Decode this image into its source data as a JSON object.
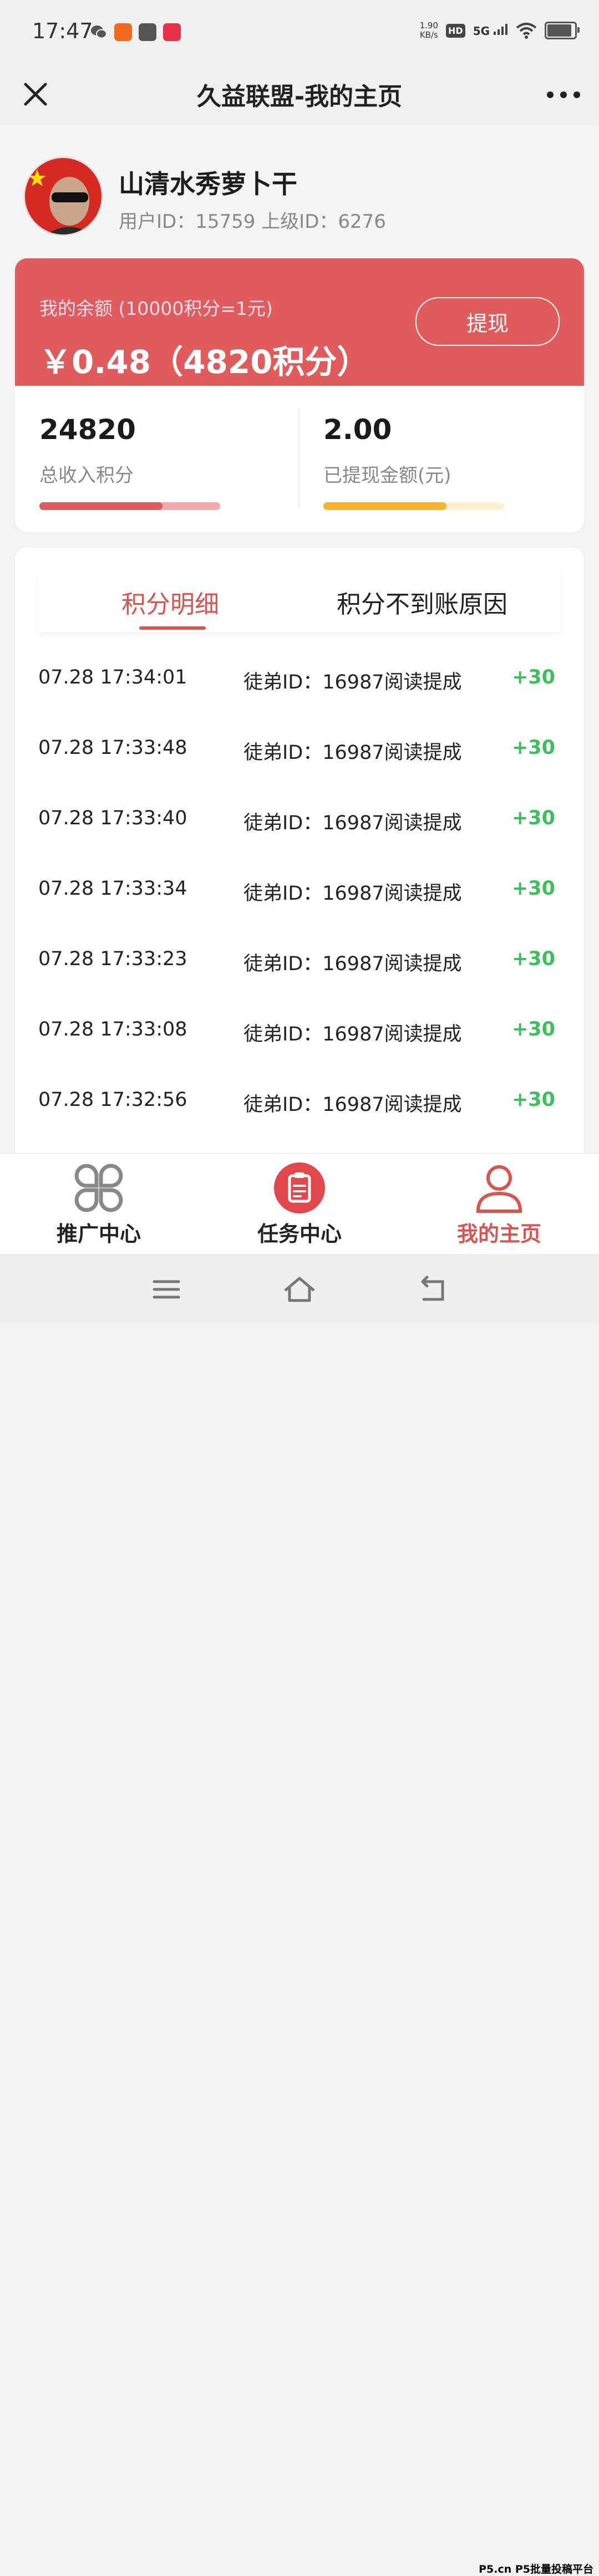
{
  "status_bar": {
    "time": "17:47",
    "net_speed_value": "1.90",
    "net_speed_unit": "KB/s",
    "hd_label": "HD",
    "network_label": "5G"
  },
  "navbar": {
    "title": "久益联盟-我的主页"
  },
  "profile": {
    "username": "山清水秀萝卜干",
    "ids_text": "用户ID：15759 上级ID：6276"
  },
  "balance": {
    "label": "我的余额 (10000积分=1元)",
    "amount": "￥0.48（4820积分）",
    "withdraw_label": "提现"
  },
  "stats": [
    {
      "value": "24820",
      "label": "总收入积分",
      "progress": 0.68,
      "color": "#e05b5b",
      "track": "#f2a9a9"
    },
    {
      "value": "2.00",
      "label": "已提现金额(元)",
      "progress": 0.68,
      "color": "#f5b331",
      "track": "#fdf0d2"
    }
  ],
  "tabs": {
    "active": "积分明细",
    "inactive": "积分不到账原因"
  },
  "records": [
    {
      "time": "07.28 17:34:01",
      "desc": "徒弟ID：16987阅读提成",
      "points": "+30"
    },
    {
      "time": "07.28 17:33:48",
      "desc": "徒弟ID：16987阅读提成",
      "points": "+30"
    },
    {
      "time": "07.28 17:33:40",
      "desc": "徒弟ID：16987阅读提成",
      "points": "+30"
    },
    {
      "time": "07.28 17:33:34",
      "desc": "徒弟ID：16987阅读提成",
      "points": "+30"
    },
    {
      "time": "07.28 17:33:23",
      "desc": "徒弟ID：16987阅读提成",
      "points": "+30"
    },
    {
      "time": "07.28 17:33:08",
      "desc": "徒弟ID：16987阅读提成",
      "points": "+30"
    },
    {
      "time": "07.28 17:32:56",
      "desc": "徒弟ID：16987阅读提成",
      "points": "+30"
    }
  ],
  "tabbar": {
    "items": [
      {
        "label": "推广中心",
        "icon": "clover-icon",
        "color": "#222"
      },
      {
        "label": "任务中心",
        "icon": "clipboard-icon",
        "color": "#222"
      },
      {
        "label": "我的主页",
        "icon": "user-icon",
        "color": "#d9534f"
      }
    ]
  },
  "watermark": "P5.cn P5批量投稿平台",
  "colors": {
    "accent": "#e05b5b",
    "positive": "#3cbf5c"
  }
}
